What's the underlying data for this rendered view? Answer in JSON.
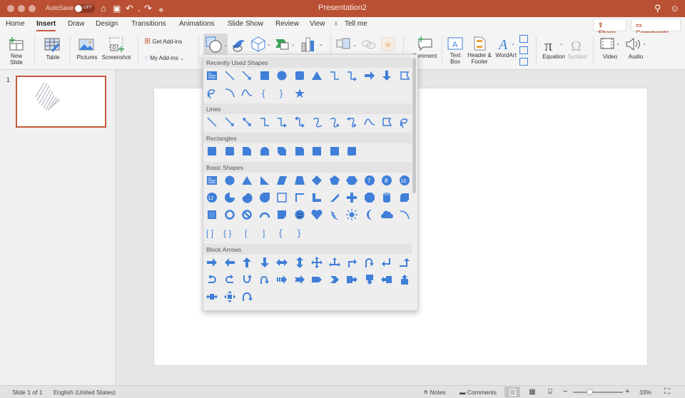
{
  "titlebar": {
    "autosave_label": "AutoSave",
    "autosave_state": "OFF",
    "title": "Presentation2"
  },
  "tabs": [
    {
      "label": "Home"
    },
    {
      "label": "Insert",
      "active": true
    },
    {
      "label": "Draw"
    },
    {
      "label": "Design"
    },
    {
      "label": "Transitions"
    },
    {
      "label": "Animations"
    },
    {
      "label": "Slide Show"
    },
    {
      "label": "Review"
    },
    {
      "label": "View"
    },
    {
      "label": "Tell me"
    }
  ],
  "actions": {
    "share": "Share",
    "comments": "Comments"
  },
  "ribbon": {
    "new_slide": "New\nSlide",
    "table": "Table",
    "pictures": "Pictures",
    "screenshot": "Screenshot",
    "get_addins": "Get Add-ins",
    "my_addins": "My Add-ins",
    "comment": "Comment",
    "text_box": "Text\nBox",
    "header_footer": "Header &\nFooter",
    "wordart": "WordArt",
    "equation": "Equation",
    "symbol": "Symbol",
    "video": "Video",
    "audio": "Audio"
  },
  "gallery": {
    "sections": [
      {
        "title": "Recently Used Shapes",
        "count": 18
      },
      {
        "title": "Lines",
        "count": 12
      },
      {
        "title": "Rectangles",
        "count": 9
      },
      {
        "title": "Basic Shapes",
        "count": 42
      },
      {
        "title": "Block Arrows",
        "count": 27
      }
    ],
    "accent_color": "#3f7fd9"
  },
  "left_pane": {
    "slide_number": "1"
  },
  "statusbar": {
    "slide_info": "Slide 1 of 1",
    "language": "English (United States)",
    "notes": "Notes",
    "comments": "Comments",
    "zoom_minus": "−",
    "zoom_plus": "+",
    "zoom_level": "33%",
    "zoom_fraction": 0.33
  },
  "colors": {
    "brand": "#b94f33",
    "accent": "#c45a3b",
    "shape_blue": "#3f7fd9"
  }
}
